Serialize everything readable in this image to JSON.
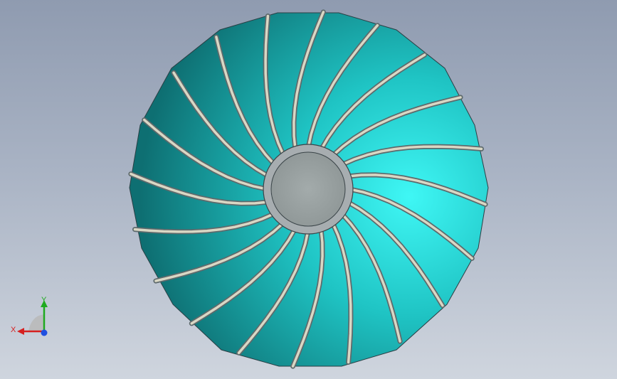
{
  "scene": {
    "model": "fan-impeller",
    "blade_count": 20,
    "colors": {
      "background_top": "#8f9bb0",
      "background_bottom": "#cfd5de",
      "blade_dark": "#0e7d80",
      "blade_light": "#35f0ee",
      "blade_edge": "#d9d7c4",
      "hub": "#9aa3a3"
    }
  },
  "triad": {
    "x_label": "X",
    "y_label": "Y",
    "x_color": "#d62020",
    "y_color": "#1faa1f",
    "z_color": "#2050e0"
  }
}
